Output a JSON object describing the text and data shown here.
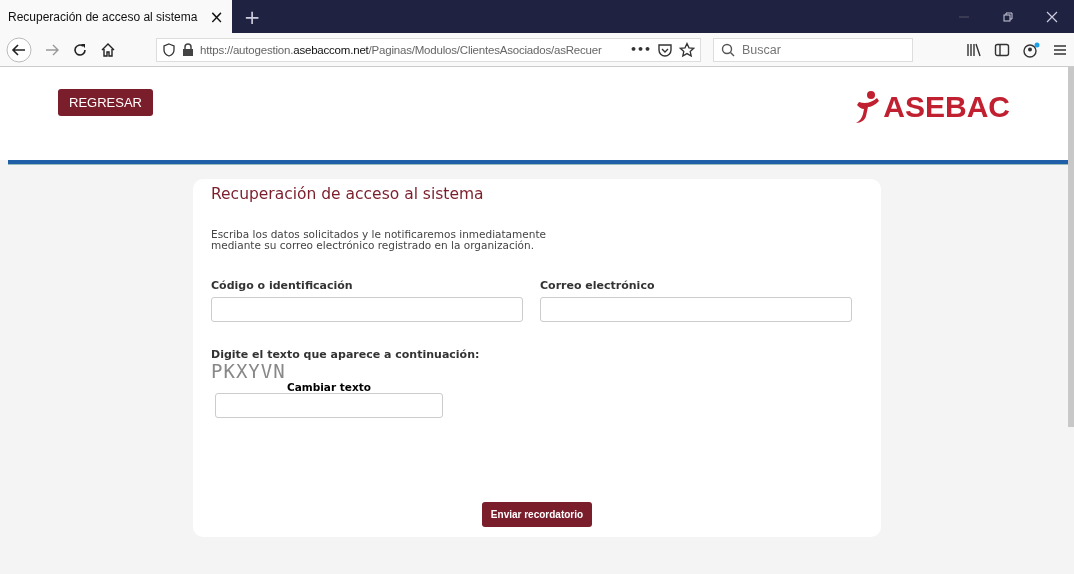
{
  "browser": {
    "tab": {
      "title": "Recuperación de acceso al sistema",
      "close": "×",
      "selected": true
    },
    "new_tab": "+",
    "url": {
      "prefix": "https://autogestion.",
      "domain": "asebaccom.net",
      "path": "/Paginas/Modulos/ClientesAsociados/asRecuer"
    },
    "url_more": "•••",
    "search": {
      "placeholder": "Buscar"
    }
  },
  "header": {
    "back_button": "REGRESAR",
    "logo": "ASEBAC"
  },
  "form": {
    "title": "Recuperación de acceso al sistema",
    "description": "Escriba los datos solicitados y le notificaremos inmediatamente\nmediante su correo electrónico registrado en la organización.",
    "fields": [
      {
        "label": "Código o identificación"
      },
      {
        "label": "Correo electrónico"
      }
    ],
    "captcha": {
      "label": "Digite el texto que aparece a continuación:",
      "text": "PKXYVN",
      "change_link": "Cambiar texto"
    },
    "submit": "Enviar recordatorio"
  }
}
